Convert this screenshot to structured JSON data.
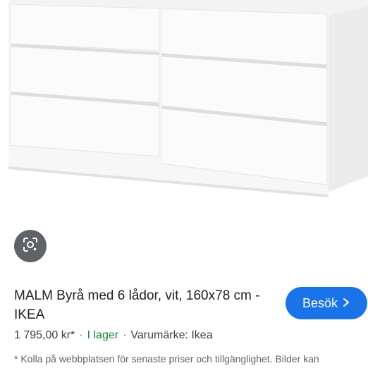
{
  "product": {
    "title": "MALM Byrå med 6 lådor, vit, 160x78 cm - IKEA",
    "price": "1 795,00 kr*",
    "separator": "·",
    "availability": "I lager",
    "brand": "Varumärke: Ikea",
    "disclaimer": "* Kolla på webbplatsen för senaste priser och tillgänglighet. Bilder kan"
  },
  "actions": {
    "visit_label": "Besök",
    "visit_icon": "chevron-right-icon",
    "lens_icon": "lens-search-icon"
  },
  "colors": {
    "accent": "#1a73e8",
    "in_stock": "#188038",
    "lens_bg": "#5f6368"
  }
}
